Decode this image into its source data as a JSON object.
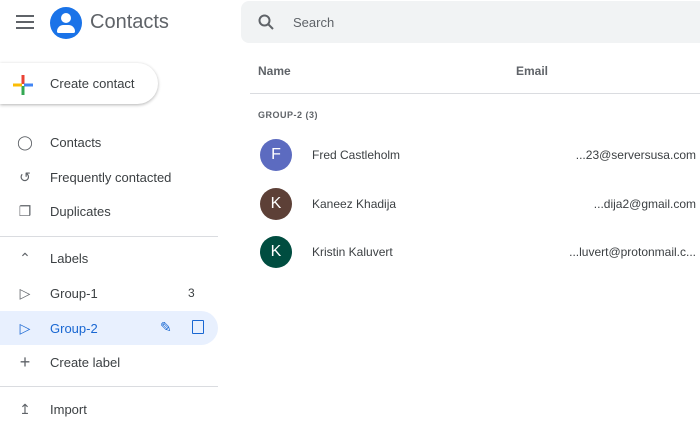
{
  "app": {
    "title": "Contacts"
  },
  "create_button": "Create contact",
  "search": {
    "placeholder": "Search"
  },
  "sidebar": {
    "items": [
      {
        "label": "Contacts"
      },
      {
        "label": "Frequently contacted"
      },
      {
        "label": "Duplicates"
      }
    ],
    "labels_header": "Labels",
    "labels": [
      {
        "label": "Group-1",
        "count": "3"
      },
      {
        "label": "Group-2"
      }
    ],
    "create_label": "Create label",
    "import": "Import"
  },
  "table": {
    "columns": [
      "Name",
      "Email"
    ],
    "group_heading": "GROUP-2 (3)",
    "rows": [
      {
        "initial": "F",
        "name": "Fred Castleholm",
        "email": "...23@serversusa.com",
        "color": "#5c6bc0"
      },
      {
        "initial": "K",
        "name": "Kaneez Khadija",
        "email": "...dija2@gmail.com",
        "color": "#5d4037"
      },
      {
        "initial": "K",
        "name": "Kristin Kaluvert",
        "email": "...luvert@protonmail.c...",
        "color": "#004d40"
      }
    ]
  }
}
